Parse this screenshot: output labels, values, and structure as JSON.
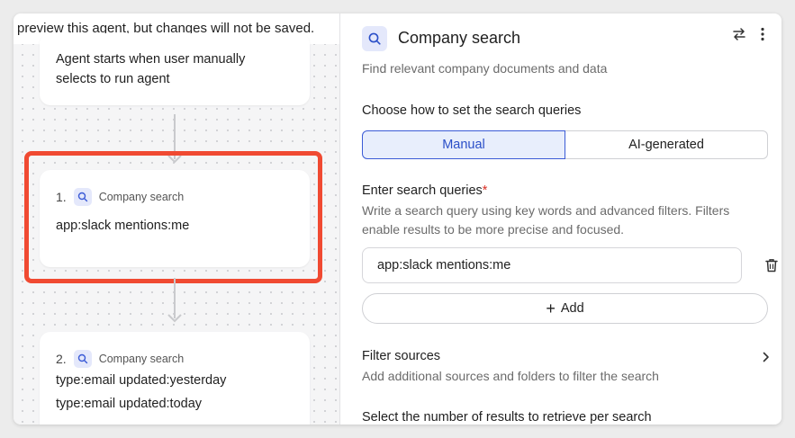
{
  "banner": {
    "text": "preview this agent, but changes will not be saved."
  },
  "canvas": {
    "trigger": {
      "line1": "Agent starts when user manually",
      "line2": "selects to run agent"
    },
    "steps": [
      {
        "number": "1.",
        "title": "Company search",
        "queries": [
          "app:slack mentions:me"
        ]
      },
      {
        "number": "2.",
        "title": "Company search",
        "queries": [
          "type:email updated:yesterday",
          "type:email updated:today"
        ]
      }
    ]
  },
  "panel": {
    "title": "Company search",
    "subtitle": "Find relevant company documents and data",
    "mode_label": "Choose how to set the search queries",
    "mode_options": {
      "manual": "Manual",
      "ai": "AI-generated"
    },
    "queries_label": "Enter search queries",
    "required_mark": "*",
    "queries_help_1": "Write a search query using key words and advanced filters. Filters",
    "queries_help_2": "enable results to be more precise and focused.",
    "query_value": "app:slack mentions:me",
    "add_label": "Add",
    "add_plus": "+",
    "filter_label": "Filter sources",
    "filter_help": "Add additional sources and folders to filter the search",
    "results_label": "Select the number of results to retrieve per search"
  },
  "colors": {
    "highlight": "#f04a32",
    "accent": "#3b5bd6",
    "accent_bg": "#e8eefc"
  }
}
